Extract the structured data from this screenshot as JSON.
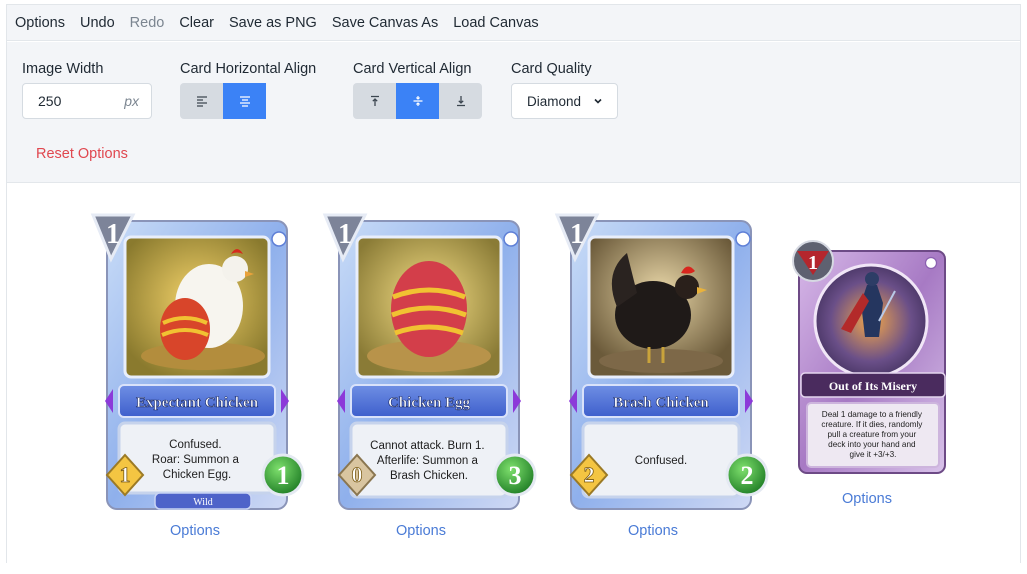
{
  "menu": {
    "options": "Options",
    "undo": "Undo",
    "redo": "Redo",
    "clear": "Clear",
    "save_png": "Save as PNG",
    "save_canvas": "Save Canvas As",
    "load_canvas": "Load Canvas"
  },
  "options_panel": {
    "image_width": {
      "label": "Image Width",
      "value": "250",
      "unit": "px"
    },
    "horizontal_align": {
      "label": "Card Horizontal Align",
      "selected": "center"
    },
    "vertical_align": {
      "label": "Card Vertical Align",
      "selected": "middle"
    },
    "quality": {
      "label": "Card Quality",
      "value": "Diamond"
    },
    "reset_label": "Reset Options"
  },
  "colors": {
    "accent": "#3b82f6",
    "reset": "#e0474f",
    "link": "#4a7bd6"
  },
  "cards": [
    {
      "name": "Expectant Chicken",
      "cost": "1",
      "text": [
        "Confused.",
        "Roar: Summon a",
        "Chicken Egg."
      ],
      "attack": "1",
      "health": "1",
      "tag": "Wild",
      "options_label": "Options",
      "type": "creature",
      "art": "chicken-with-egg"
    },
    {
      "name": "Chicken Egg",
      "cost": "1",
      "text": [
        "Cannot attack. Burn 1.",
        "Afterlife: Summon a",
        "Brash Chicken."
      ],
      "attack": "0",
      "health": "3",
      "options_label": "Options",
      "type": "creature",
      "art": "egg"
    },
    {
      "name": "Brash Chicken",
      "cost": "1",
      "text": [
        "Confused."
      ],
      "attack": "2",
      "health": "2",
      "options_label": "Options",
      "type": "creature",
      "art": "rooster"
    },
    {
      "name": "Out of Its Misery",
      "cost": "1",
      "text": [
        "Deal 1 damage to a friendly",
        "creature. If it dies, randomly",
        "pull a creature from your",
        "deck into your hand and",
        "give it +3/+3."
      ],
      "options_label": "Options",
      "type": "spell",
      "art": "warrior"
    }
  ]
}
